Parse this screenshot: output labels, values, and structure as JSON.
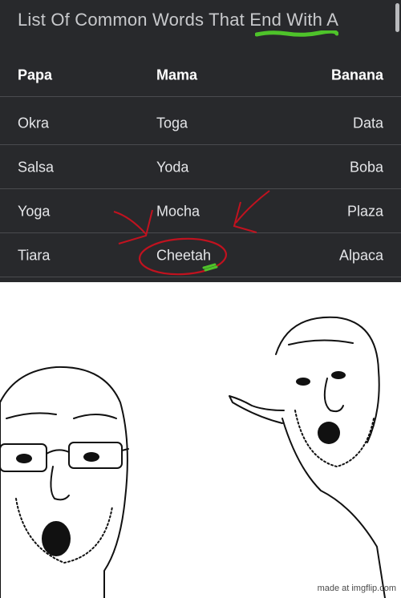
{
  "list": {
    "title": "List Of Common Words That End With A",
    "header": [
      "Papa",
      "Mama",
      "Banana"
    ],
    "rows": [
      [
        "Okra",
        "Toga",
        "Data"
      ],
      [
        "Salsa",
        "Yoda",
        "Boba"
      ],
      [
        "Yoga",
        "Mocha",
        "Plaza"
      ],
      [
        "Tiara",
        "Cheetah",
        "Alpaca"
      ]
    ]
  },
  "annotation": {
    "highlight_color": "#4ec32a",
    "ink_color": "#c1121f",
    "circled_word": "Cheetah"
  },
  "meme": {
    "watermark": "made at imgflip.com"
  },
  "colors": {
    "panel_bg": "#28292c",
    "text": "#e4e5e8",
    "separator": "#4a4b4f"
  }
}
